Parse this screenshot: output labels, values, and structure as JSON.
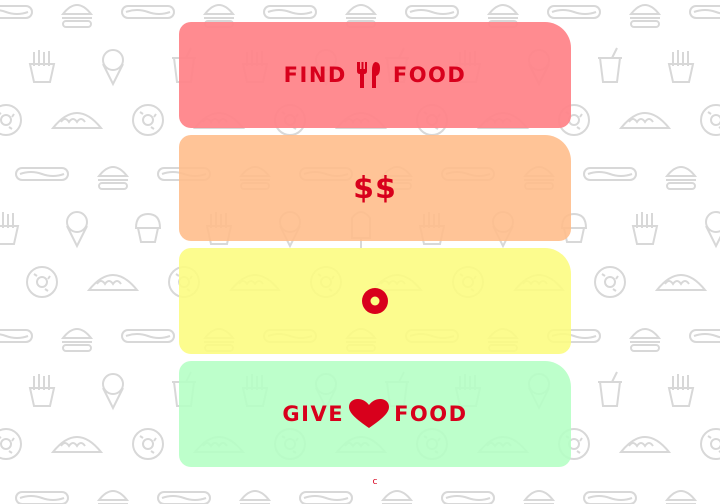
{
  "cards": [
    {
      "label_left": "FIND",
      "icon": "fork-knife-icon",
      "label_right": "FOOD",
      "color": "#ff8288"
    },
    {
      "label": "$$",
      "color": "#ffbe8c"
    },
    {
      "icon": "donut-icon",
      "color": "#fcfc82"
    },
    {
      "label_left": "GIVE",
      "icon": "heart-icon",
      "label_right": "FOOD",
      "color": "#b4ffc4"
    }
  ],
  "footer": {
    "mark": "c"
  },
  "accent_color": "#d8001c",
  "background_icons": [
    "burger-icon",
    "hotdog-icon",
    "fries-icon",
    "ice-cream-cone-icon",
    "soda-cup-icon",
    "taco-icon",
    "donut-icon",
    "popsicle-icon",
    "cupcake-icon"
  ]
}
